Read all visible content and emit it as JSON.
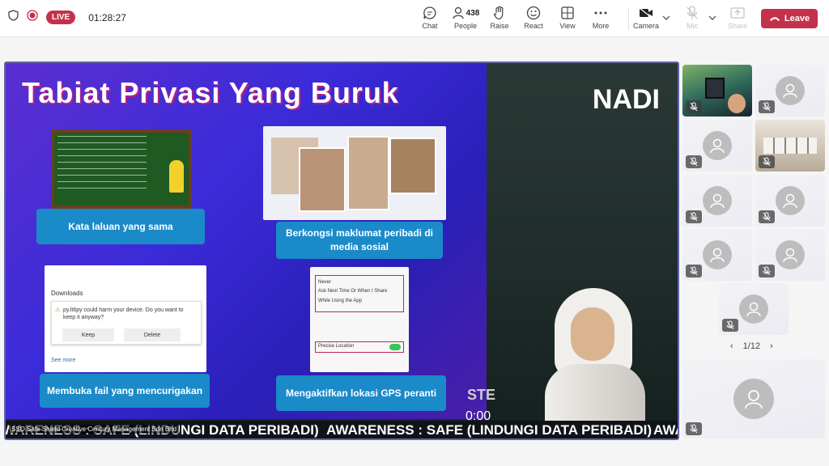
{
  "topbar": {
    "live_label": "LIVE",
    "timer": "01:28:27",
    "buttons": [
      {
        "id": "chat",
        "label": "Chat",
        "icon": "chat-icon"
      },
      {
        "id": "people",
        "label": "People",
        "icon": "people-icon",
        "count": "438"
      },
      {
        "id": "raise",
        "label": "Raise",
        "icon": "hand-icon"
      },
      {
        "id": "react",
        "label": "React",
        "icon": "smile-icon"
      },
      {
        "id": "view",
        "label": "View",
        "icon": "grid-icon"
      },
      {
        "id": "more",
        "label": "More",
        "icon": "ellipsis-icon"
      },
      {
        "id": "camera",
        "label": "Camera",
        "icon": "camera-off-icon"
      },
      {
        "id": "mic",
        "label": "Mic",
        "icon": "mic-off-icon"
      },
      {
        "id": "share",
        "label": "Share",
        "icon": "share-icon"
      }
    ],
    "leave_label": "Leave",
    "leave_color": "#c4314b"
  },
  "slide": {
    "title": "Tabiat Privasi Yang Buruk",
    "cards": [
      "Kata laluan yang sama",
      "Berkongsi maklumat peribadi di media sosial",
      "Membuka fail yang mencurigakan",
      "Mengaktifkan lokasi GPS peranti"
    ],
    "downloads_title": "Downloads",
    "downloads_message": "py.lt6py could harm your device. Do you want to keep it anyway?",
    "keep_label": "Keep",
    "delete_label": "Delete",
    "see_more": "See more",
    "location_options": [
      "Never",
      "Ask Next Time Or When I Share",
      "While Using the App"
    ],
    "precise_location": "Precise Location"
  },
  "speaker": {
    "brand": "NADI",
    "overlay_text": "STE",
    "clock": "0:00"
  },
  "ticker": {
    "caption": "SSO Safe Shield Creative Century Management Sdn Bhd",
    "segments": [
      "WARENESS : SAFE (LINDUNGI DATA PERIBADI)",
      "AWARENESS : SAFE (LINDUNGI DATA PERIBADI)",
      "AWA"
    ]
  },
  "pager": {
    "text": "1/12"
  }
}
